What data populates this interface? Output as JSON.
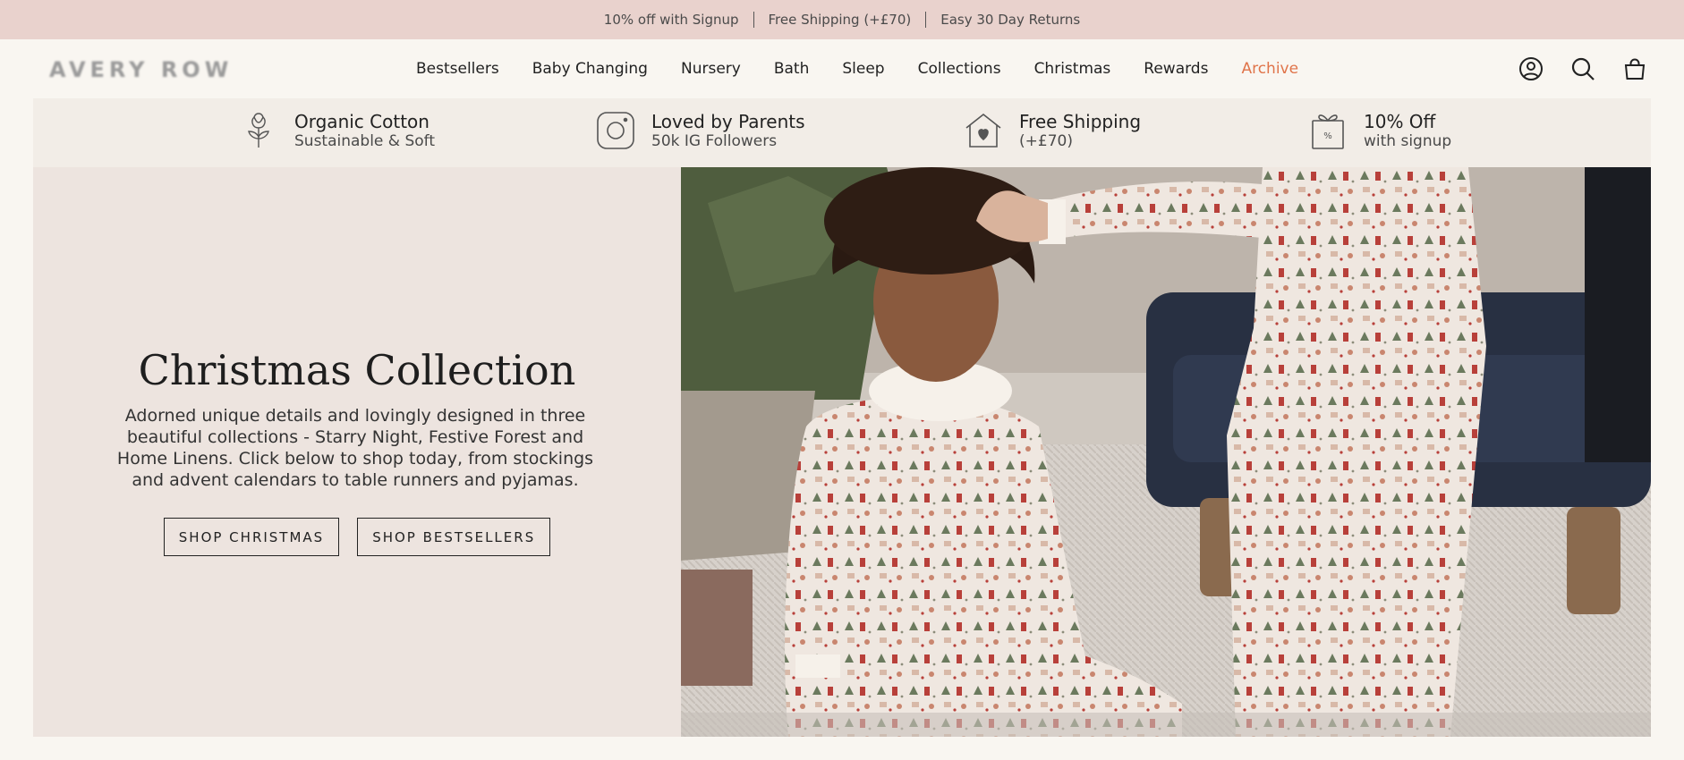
{
  "announcement": {
    "items": [
      "10% off with Signup",
      "Free Shipping (+£70)",
      "Easy 30 Day Returns"
    ]
  },
  "header": {
    "logo": "AVERY ROW",
    "nav": [
      "Bestsellers",
      "Baby Changing",
      "Nursery",
      "Bath",
      "Sleep",
      "Collections",
      "Christmas",
      "Rewards",
      "Archive"
    ],
    "accent_color": "#e0744a",
    "icons": [
      "account-icon",
      "search-icon",
      "cart-icon"
    ]
  },
  "features": [
    {
      "icon": "cotton-flower-icon",
      "title": "Organic Cotton",
      "subtitle": "Sustainable & Soft"
    },
    {
      "icon": "instagram-icon",
      "title": "Loved by Parents",
      "subtitle": "50k IG Followers"
    },
    {
      "icon": "house-heart-icon",
      "title": "Free Shipping",
      "subtitle": "(+£70)"
    },
    {
      "icon": "gift-tag-icon",
      "title": "10% Off",
      "subtitle": "with signup"
    }
  ],
  "hero": {
    "title": "Christmas Collection",
    "text": "Adorned unique details and lovingly designed in three beautiful collections - Starry Night, Festive Forest and Home Linens. Click below to shop today, from stockings and advent calendars to table runners and pyjamas.",
    "buttons": [
      "SHOP CHRISTMAS",
      "SHOP BESTSELLERS"
    ]
  },
  "colors": {
    "announcement_bg": "#e9d2cd",
    "page_bg": "#f9f6f1",
    "features_bg": "#f2ede7",
    "hero_left_bg": "#ede4df"
  }
}
